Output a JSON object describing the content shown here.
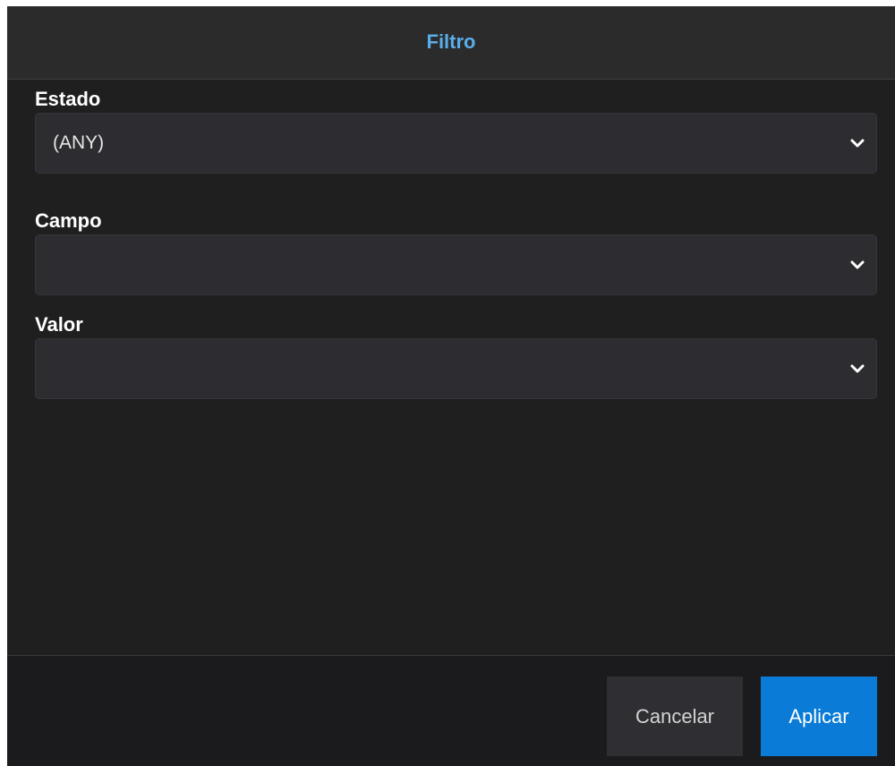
{
  "dialog": {
    "title": "Filtro"
  },
  "fields": [
    {
      "label": "Estado",
      "value": "(ANY)"
    },
    {
      "label": "Campo",
      "value": ""
    },
    {
      "label": "Valor",
      "value": ""
    }
  ],
  "footer": {
    "cancel_label": "Cancelar",
    "apply_label": "Aplicar"
  },
  "colors": {
    "title_accent": "#5aaee8",
    "primary_button": "#0a7bd6",
    "dialog_background": "#1f1f1f"
  },
  "icons": {
    "dropdown": "chevron-down-icon"
  }
}
